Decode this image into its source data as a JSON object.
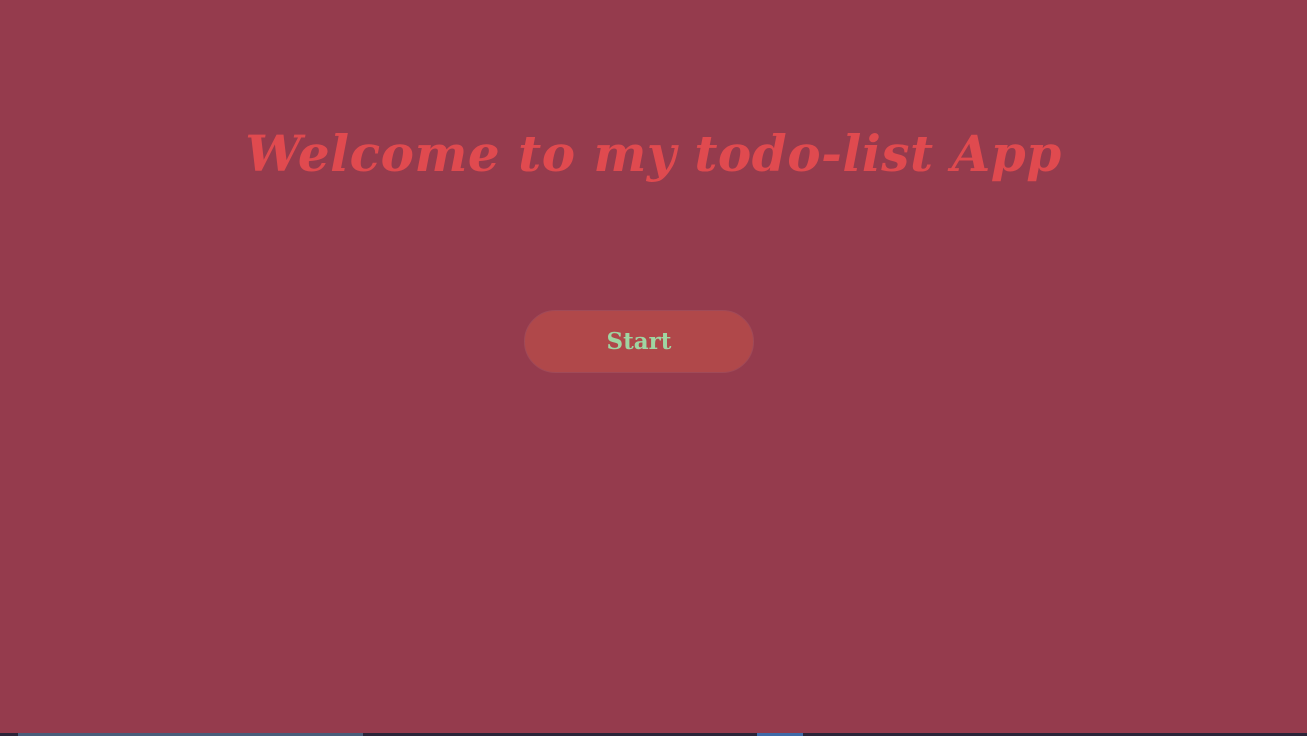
{
  "page": {
    "title": "Welcome to my todo-list App",
    "start_label": "Start"
  },
  "colors": {
    "background": "#953b4d",
    "title": "#e04a4f",
    "button_bg": "#b0484a",
    "button_text": "#9fd6a2"
  }
}
